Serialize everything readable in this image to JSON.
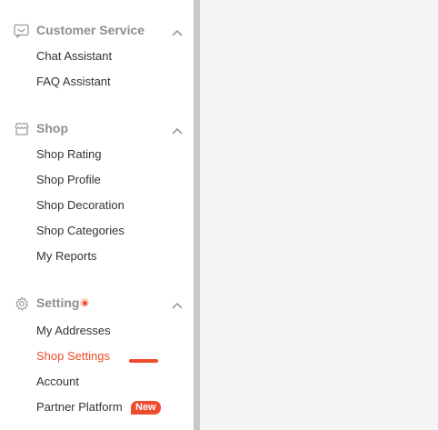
{
  "sidebar": {
    "sections": [
      {
        "title": "Customer Service",
        "icon": "chat-window-icon",
        "expanded": true,
        "items": [
          {
            "label": "Chat Assistant"
          },
          {
            "label": "FAQ Assistant"
          }
        ]
      },
      {
        "title": "Shop",
        "icon": "storefront-icon",
        "expanded": true,
        "items": [
          {
            "label": "Shop Rating"
          },
          {
            "label": "Shop Profile"
          },
          {
            "label": "Shop Decoration"
          },
          {
            "label": "Shop Categories"
          },
          {
            "label": "My Reports"
          }
        ]
      },
      {
        "title": "Setting",
        "icon": "gear-icon",
        "expanded": true,
        "has_notification_dot": true,
        "items": [
          {
            "label": "My Addresses"
          },
          {
            "label": "Shop Settings",
            "active": true
          },
          {
            "label": "Account"
          },
          {
            "label": "Partner Platform",
            "badge": "New"
          }
        ]
      }
    ]
  },
  "colors": {
    "accent": "#ee4d2d",
    "section_title": "#8e8e8e",
    "item_text": "#333333",
    "content_background": "#f4f4f4",
    "sidebar_background": "#ffffff"
  }
}
